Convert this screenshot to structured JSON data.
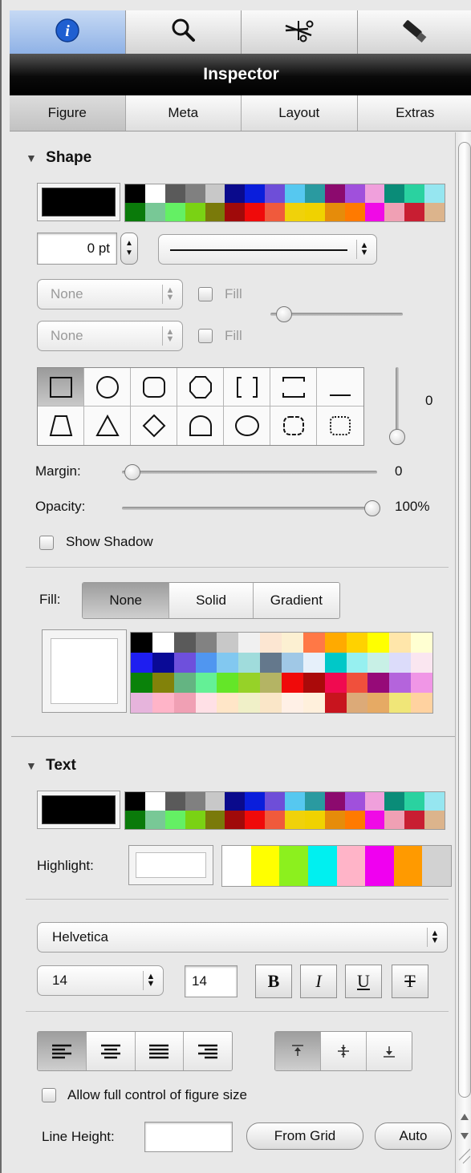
{
  "toolbar": {
    "items": [
      {
        "icon": "info-icon"
      },
      {
        "icon": "search-icon"
      },
      {
        "icon": "scissors-icon"
      },
      {
        "icon": "flashlight-icon"
      }
    ]
  },
  "title": "Inspector",
  "tabs": [
    "Figure",
    "Meta",
    "Layout",
    "Extras"
  ],
  "shape": {
    "header": "Shape",
    "color_row1": [
      "#000000",
      "#ffffff",
      "#5a5a5a",
      "#808080",
      "#c8c8c8",
      "#0a0a8c",
      "#0a1edc",
      "#6e4ed8",
      "#56c8f0",
      "#2a9aa0",
      "#8c0a6e",
      "#a050dc",
      "#f0a0dc",
      "#0a8c78",
      "#2ad2a0",
      "#96e6f0"
    ],
    "color_row2": [
      "#0a7a0a",
      "#78c896",
      "#64f064",
      "#7ad214",
      "#7a7a0a",
      "#a00a0a",
      "#f00a0a",
      "#f05a3c",
      "#f0d20a",
      "#f0d200",
      "#e68c0a",
      "#ff7a00",
      "#f00ae6",
      "#f0a0b4",
      "#c81e32",
      "#dcb48c"
    ],
    "stroke_width": "0 pt",
    "arrow_start": "None",
    "arrow_end": "None",
    "fill_label": "Fill",
    "corner_value": "0",
    "margin_label": "Margin:",
    "margin_value": "0",
    "margin_fraction": 0,
    "opacity_label": "Opacity:",
    "opacity_value": "100%",
    "opacity_fraction": 1,
    "show_shadow": "Show Shadow",
    "fill_mode_label": "Fill:",
    "fill_modes": [
      "None",
      "Solid",
      "Gradient"
    ],
    "fill_palette": [
      [
        "#000000",
        "#ffffff",
        "#5a5a5a",
        "#828282",
        "#c8c8c8",
        "#f0f0f0",
        "#fce6d2",
        "#fcf0d2",
        "#ff7846",
        "#ffaa00",
        "#ffd200",
        "#ffff00",
        "#ffe6aa",
        "#ffffd2"
      ],
      [
        "#1e1ef0",
        "#0a0a96",
        "#6e50dc",
        "#5096f0",
        "#82c8f0",
        "#a0dcdc",
        "#64788c",
        "#a0c8e6",
        "#e6f0fa",
        "#00c8c8",
        "#96f0f0",
        "#c8f0e6",
        "#dcdcfa",
        "#fae6f0"
      ],
      [
        "#0a820a",
        "#82820a",
        "#64b482",
        "#64f096",
        "#64e628",
        "#96d228",
        "#b4b464",
        "#f00a0a",
        "#aa0a0a",
        "#f00a50",
        "#f0503c",
        "#960a78",
        "#b464dc",
        "#f096e6"
      ],
      [
        "#e6b4dc",
        "#ffb4c8",
        "#f0a0b4",
        "#ffe0e6",
        "#ffe6c8",
        "#f0f0c8",
        "#fae6c8",
        "#fff0e6",
        "#fff0dc",
        "#c8141e",
        "#dcaa78",
        "#e6aa64",
        "#f0e678",
        "#ffd2a0"
      ]
    ]
  },
  "text": {
    "header": "Text",
    "highlight_label": "Highlight:",
    "highlight_colors": [
      "#ffffff",
      "#ffff00",
      "#8cf01e",
      "#00f0f0",
      "#ffb4c8",
      "#f000f0",
      "#ff9a00",
      "#d2d2d2"
    ],
    "font": "Helvetica",
    "font_size_popup": "14",
    "font_size_field": "14",
    "style_buttons": [
      "B",
      "I",
      "U",
      "T"
    ],
    "allow_full_control": "Allow full control of figure size",
    "line_height_label": "Line Height:",
    "line_height_value": "",
    "from_grid": "From Grid",
    "auto": "Auto"
  }
}
